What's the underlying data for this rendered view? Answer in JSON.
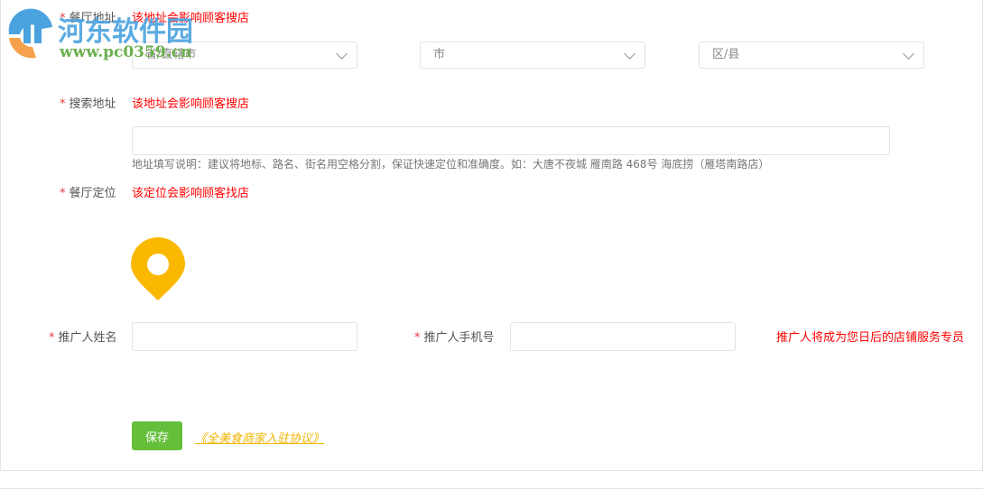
{
  "watermark": {
    "name": "河东软件园",
    "url": "www.pc0359.cn"
  },
  "address": {
    "label": "餐厅地址",
    "hint": "该地址会影响顾客搜店",
    "province": "省/直辖市",
    "city": "市",
    "district": "区/县"
  },
  "search": {
    "label": "搜索地址",
    "hint": "该地址会影响顾客搜店",
    "value": "",
    "note": "地址填写说明：建议将地标、路名、街名用空格分割，保证快速定位和准确度。如：大唐不夜城 雁南路 468号 海底捞（雁塔南路店）"
  },
  "location": {
    "label": "餐厅定位",
    "hint": "该定位会影响顾客找店"
  },
  "promoter": {
    "name_label": "推广人姓名",
    "phone_label": "推广人手机号",
    "hint": "推广人将成为您日后的店铺服务专员"
  },
  "actions": {
    "save": "保存",
    "agreement": "《全美食商家入驻协议》"
  },
  "colors": {
    "accent": "#65bf3b",
    "required": "#e4393c",
    "pin": "#fbb800"
  }
}
